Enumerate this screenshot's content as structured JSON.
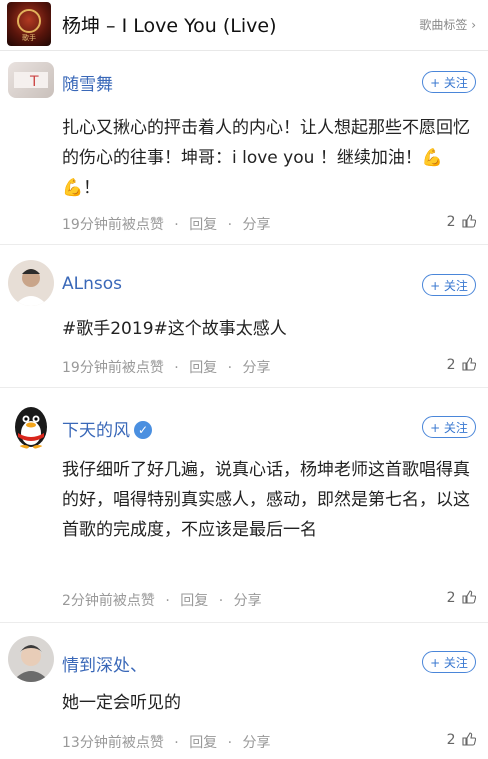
{
  "header": {
    "song_title": "杨坤 – I Love You (Live)",
    "tag_button": "歌曲标签 ›",
    "album_tag": "歌手"
  },
  "comments": [
    {
      "user": "随雪舞",
      "follow": "+ 关注",
      "text": "扎心又揪心的抨击着人的内心！让人想起那些不愿回忆的伤心的往事！坤哥：i love you ！继续加油！💪💪！",
      "time": "19分钟前被点赞",
      "reply": "回复",
      "share": "分享",
      "likes": "2"
    },
    {
      "user": "ALnsos",
      "follow": "+ 关注",
      "text": "#歌手2019#这个故事太感人",
      "time": "19分钟前被点赞",
      "reply": "回复",
      "share": "分享",
      "likes": "2"
    },
    {
      "user": "下天的风",
      "follow": "+ 关注",
      "text": "我仔细听了好几遍，说真心话，杨坤老师这首歌唱得真的好，唱得特别真实感人，感动，即然是第七名，以这首歌的完成度，不应该是最后一名",
      "time": "2分钟前被点赞",
      "reply": "回复",
      "share": "分享",
      "likes": "2"
    },
    {
      "user": "情到深处、",
      "follow": "+ 关注",
      "text": "她一定会听见的",
      "time": "13分钟前被点赞",
      "reply": "回复",
      "share": "分享",
      "likes": "2"
    }
  ],
  "colors": {
    "username": "#3a68b8",
    "follow": "#3a78d0",
    "meta": "#999999"
  }
}
